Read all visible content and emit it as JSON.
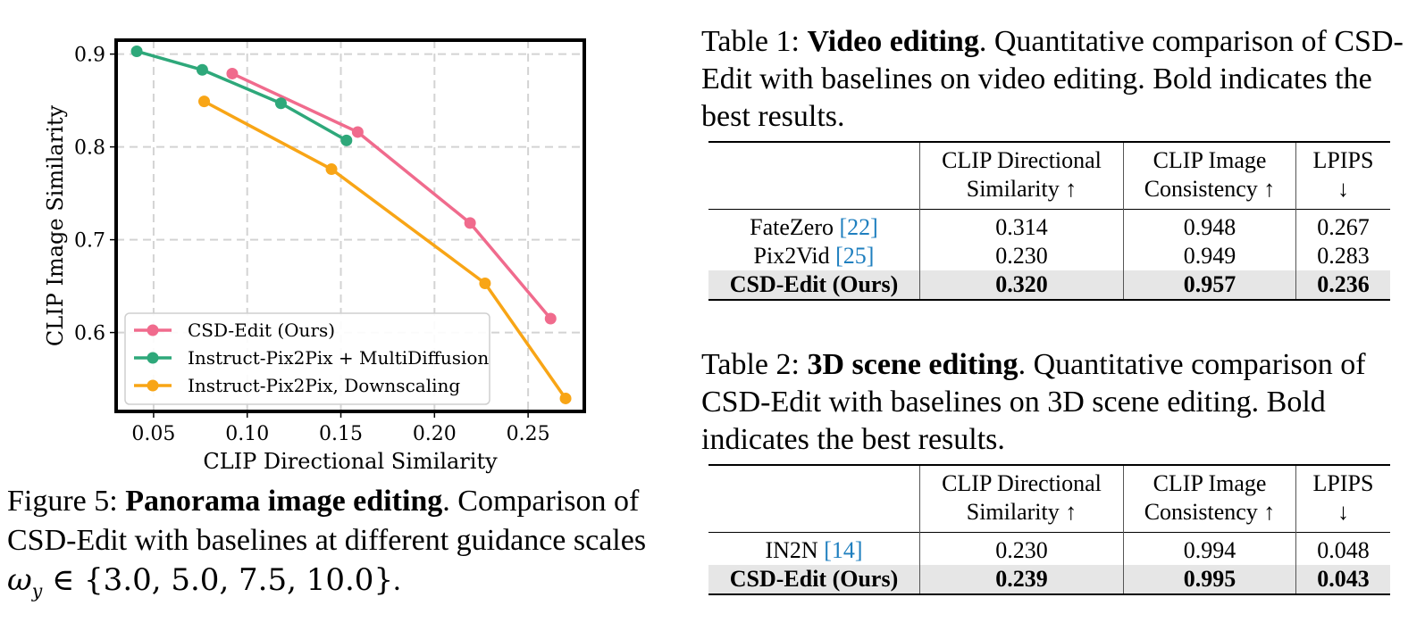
{
  "figure": {
    "caption_label": "Figure 5:",
    "caption_title": "Panorama image editing",
    "caption_text": ". Comparison of CSD-Edit with baselines at different guidance scales",
    "caption_math_symbol": "ω",
    "caption_math_sub": "y",
    "caption_math_set": " ∈ {3.0, 5.0, 7.5, 10.0}",
    "caption_end": "."
  },
  "chart_data": {
    "type": "line",
    "xlabel": "CLIP Directional Similarity",
    "ylabel": "CLIP Image Similarity",
    "xlim": [
      0.03,
      0.28
    ],
    "ylim": [
      0.515,
      0.915
    ],
    "xticks": [
      "0.05",
      "0.10",
      "0.15",
      "0.20",
      "0.25"
    ],
    "yticks": [
      "0.6",
      "0.7",
      "0.8",
      "0.9"
    ],
    "grid": true,
    "legend_position": "lower-left",
    "series": [
      {
        "name": "CSD-Edit (Ours)",
        "color": "#f06b8d",
        "x": [
          0.092,
          0.159,
          0.219,
          0.262
        ],
        "y": [
          0.879,
          0.816,
          0.718,
          0.615
        ]
      },
      {
        "name": "Instruct-Pix2Pix + MultiDiffusion",
        "color": "#2ea87a",
        "x": [
          0.041,
          0.076,
          0.118,
          0.153
        ],
        "y": [
          0.903,
          0.883,
          0.847,
          0.807
        ]
      },
      {
        "name": "Instruct-Pix2Pix, Downscaling",
        "color": "#f8a516",
        "x": [
          0.077,
          0.145,
          0.227,
          0.27
        ],
        "y": [
          0.849,
          0.776,
          0.653,
          0.529
        ]
      }
    ]
  },
  "table1": {
    "caption_label": "Table 1:",
    "caption_title": "Video editing",
    "caption_text": ". Quantitative comparison of CSD-Edit with baselines on video editing. Bold indicates the best results.",
    "headers": [
      {
        "line1": "CLIP Directional",
        "line2": "Similarity ↑"
      },
      {
        "line1": "CLIP Image",
        "line2": "Consistency ↑"
      },
      {
        "line1": "LPIPS",
        "line2": "↓"
      }
    ],
    "rows": [
      {
        "method": "FateZero ",
        "ref": "[22]",
        "v1": "0.314",
        "v2": "0.948",
        "v3": "0.267",
        "best": false
      },
      {
        "method": "Pix2Vid ",
        "ref": "[25]",
        "v1": "0.230",
        "v2": "0.949",
        "v3": "0.283",
        "best": false
      },
      {
        "method": "CSD-Edit (Ours)",
        "ref": "",
        "v1": "0.320",
        "v2": "0.957",
        "v3": "0.236",
        "best": true
      }
    ]
  },
  "table2": {
    "caption_label": "Table 2:",
    "caption_title": "3D scene editing",
    "caption_text": ". Quantitative comparison of CSD-Edit with baselines on 3D scene editing. Bold indicates the best results.",
    "headers": [
      {
        "line1": "CLIP Directional",
        "line2": "Similarity ↑"
      },
      {
        "line1": "CLIP Image",
        "line2": "Consistency ↑"
      },
      {
        "line1": "LPIPS",
        "line2": "↓"
      }
    ],
    "rows": [
      {
        "method": "IN2N ",
        "ref": "[14]",
        "v1": "0.230",
        "v2": "0.994",
        "v3": "0.048",
        "best": false
      },
      {
        "method": "CSD-Edit (Ours)",
        "ref": "",
        "v1": "0.239",
        "v2": "0.995",
        "v3": "0.043",
        "best": true
      }
    ]
  }
}
